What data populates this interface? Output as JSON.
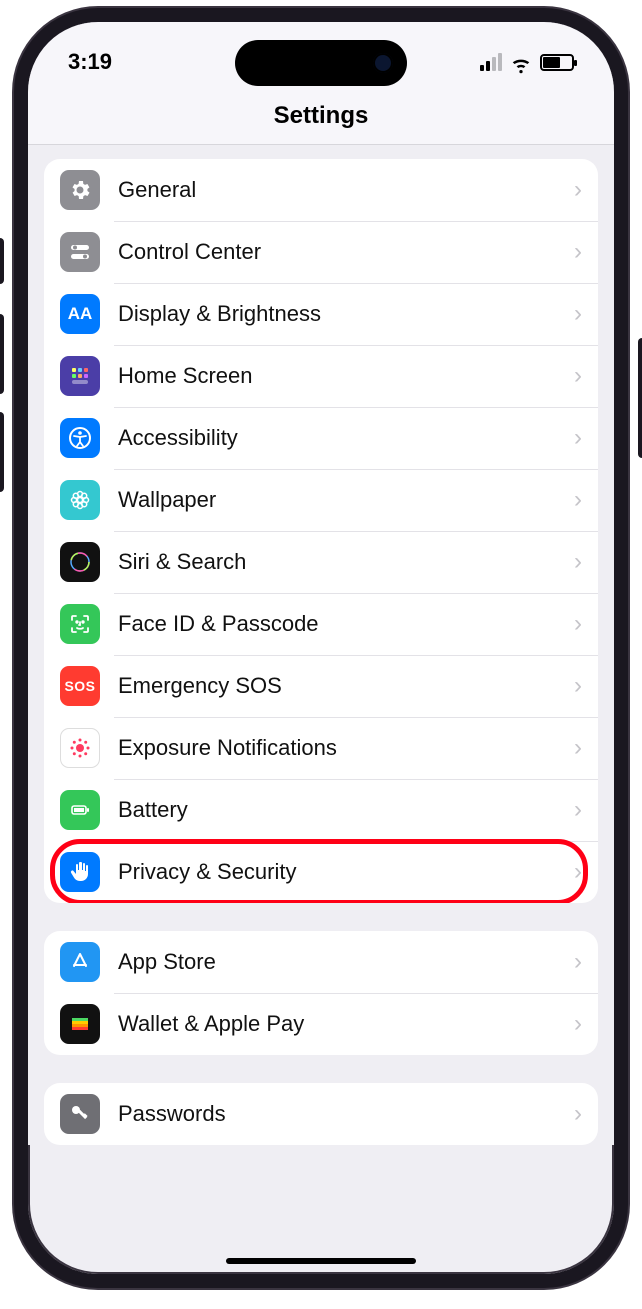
{
  "status": {
    "time": "3:19"
  },
  "header": {
    "title": "Settings"
  },
  "groups": [
    {
      "rows": [
        {
          "id": "general",
          "label": "General"
        },
        {
          "id": "control-center",
          "label": "Control Center"
        },
        {
          "id": "display-brightness",
          "label": "Display & Brightness"
        },
        {
          "id": "home-screen",
          "label": "Home Screen"
        },
        {
          "id": "accessibility",
          "label": "Accessibility"
        },
        {
          "id": "wallpaper",
          "label": "Wallpaper"
        },
        {
          "id": "siri-search",
          "label": "Siri & Search"
        },
        {
          "id": "faceid-passcode",
          "label": "Face ID & Passcode"
        },
        {
          "id": "emergency-sos",
          "label": "Emergency SOS"
        },
        {
          "id": "exposure-notifications",
          "label": "Exposure Notifications"
        },
        {
          "id": "battery",
          "label": "Battery"
        },
        {
          "id": "privacy-security",
          "label": "Privacy & Security",
          "highlighted": true
        }
      ]
    },
    {
      "rows": [
        {
          "id": "app-store",
          "label": "App Store"
        },
        {
          "id": "wallet-apple-pay",
          "label": "Wallet & Apple Pay"
        }
      ]
    },
    {
      "rows": [
        {
          "id": "passwords",
          "label": "Passwords"
        }
      ]
    }
  ]
}
